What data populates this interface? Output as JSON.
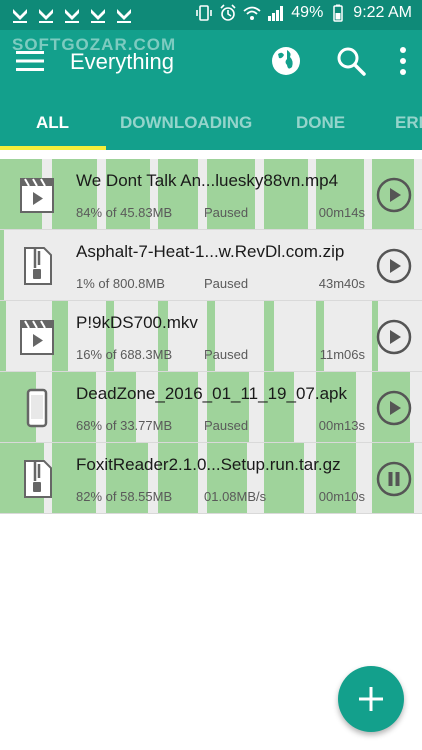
{
  "status_bar": {
    "notification_icons": [
      "download-icon",
      "download-icon",
      "download-icon",
      "download-icon",
      "download-icon"
    ],
    "battery": "49%",
    "time": "9:22 AM"
  },
  "app_bar": {
    "title": "Everything",
    "watermark": "SOFTGOZAR.COM"
  },
  "tabs": [
    {
      "label": "ALL",
      "active": true
    },
    {
      "label": "DOWNLOADING",
      "active": false
    },
    {
      "label": "DONE",
      "active": false
    },
    {
      "label": "ERR",
      "active": false
    }
  ],
  "downloads": [
    {
      "name": "We Dont Talk An...luesky88vn.mp4",
      "progress": "84% of 45.83MB",
      "status": "Paused",
      "time": "00m14s",
      "icon": "video-file-icon",
      "action": "play",
      "percent": 84
    },
    {
      "name": "Asphalt-7-Heat-1...w.RevDl.com.zip",
      "progress": "1% of 800.8MB",
      "status": "Paused",
      "time": "43m40s",
      "icon": "zip-file-icon",
      "action": "play",
      "percent": 1
    },
    {
      "name": "P!9kDS700.mkv",
      "progress": "16% of 688.3MB",
      "status": "Paused",
      "time": "11m06s",
      "icon": "video-file-icon",
      "action": "play",
      "percent": 16
    },
    {
      "name": "DeadZone_2016_01_11_19_07.apk",
      "progress": "68% of 33.77MB",
      "status": "Paused",
      "time": "00m13s",
      "icon": "phone-file-icon",
      "action": "play",
      "percent": 68
    },
    {
      "name": "FoxitReader2.1.0...Setup.run.tar.gz",
      "progress": "82% of 58.55MB",
      "status": "01.08MB/s",
      "time": "00m10s",
      "icon": "zip-file-icon",
      "action": "pause",
      "percent": 82
    }
  ],
  "colors": {
    "status_bar": "#0f8a78",
    "primary": "#13a08c",
    "indicator": "#f6ee3a",
    "segment_done": "#9fd39b",
    "row_background": "#ececec"
  }
}
